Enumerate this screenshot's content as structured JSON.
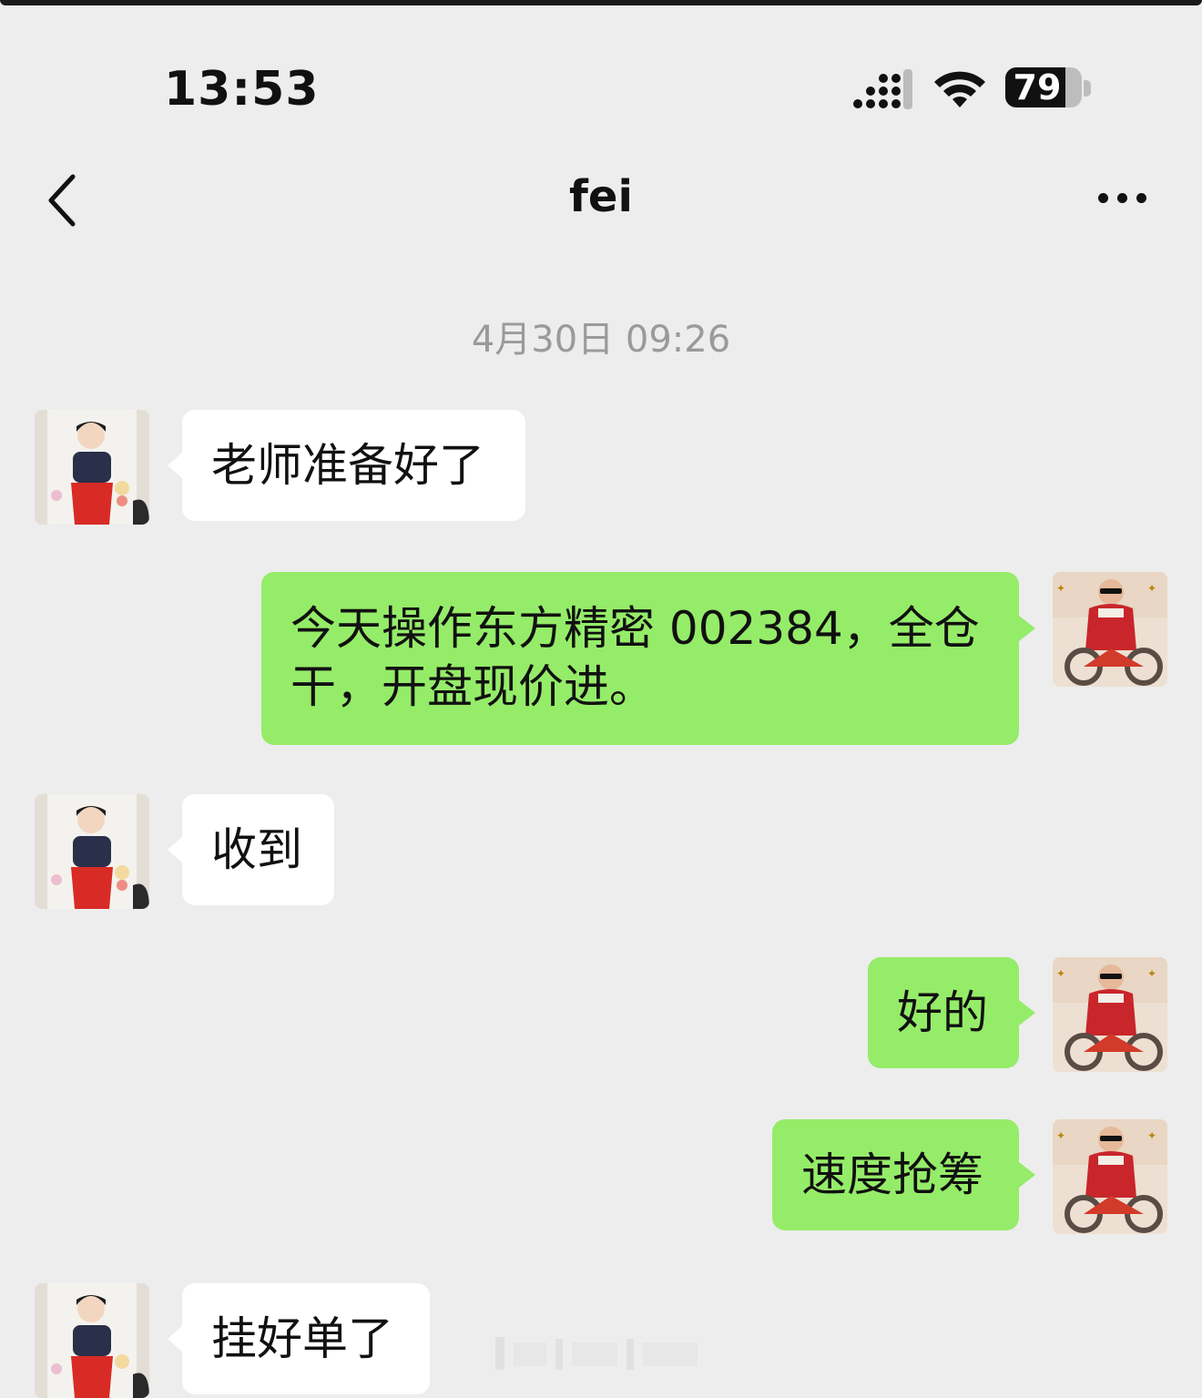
{
  "status_bar": {
    "time": "13:53",
    "battery": "79",
    "battery_level": 0.79
  },
  "header": {
    "title": "fei",
    "back_icon": "chevron-left-icon",
    "more_icon": "more-dots-icon"
  },
  "chat": {
    "timestamp": "4月30日 09:26",
    "messages": [
      {
        "sender": "other",
        "text": "老师准备好了"
      },
      {
        "sender": "me",
        "text": "今天操作东方精密 002384，全仓干，开盘现价进。"
      },
      {
        "sender": "other",
        "text": "收到"
      },
      {
        "sender": "me",
        "text": "好的"
      },
      {
        "sender": "me",
        "text": "速度抢筹"
      },
      {
        "sender": "other",
        "text": "挂好单了"
      }
    ]
  },
  "colors": {
    "background": "#ededed",
    "incoming_bubble": "#ffffff",
    "outgoing_bubble": "#95ec69",
    "timestamp": "#9a9a9a"
  }
}
